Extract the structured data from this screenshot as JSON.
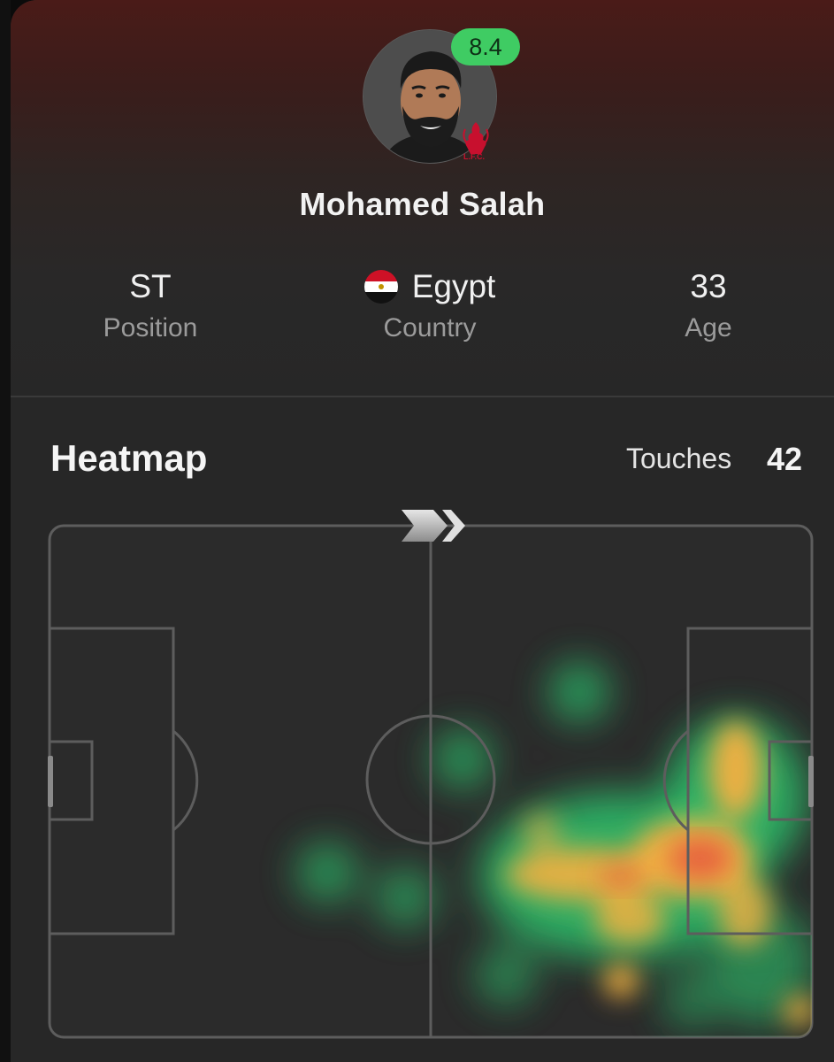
{
  "player": {
    "name": "Mohamed Salah",
    "rating": "8.4",
    "club_badge_text": "L.F.C."
  },
  "info": [
    {
      "value": "ST",
      "label": "Position"
    },
    {
      "value": "Egypt",
      "label": "Country",
      "flag": "egypt-flag-icon"
    },
    {
      "value": "33",
      "label": "Age"
    }
  ],
  "heatmap": {
    "title": "Heatmap",
    "touches_label": "Touches",
    "touches_value": "42",
    "direction_icon": "attack-direction-chevrons-icon"
  },
  "colors": {
    "rating_badge": "#3fcc63",
    "card_background": "#272727",
    "header_gradient_top": "#4a1b18",
    "pitch_lines": "#5d5d5d",
    "heat_low": "#2ecc71",
    "heat_mid": "#f5b041",
    "heat_high": "#e74c3c"
  }
}
